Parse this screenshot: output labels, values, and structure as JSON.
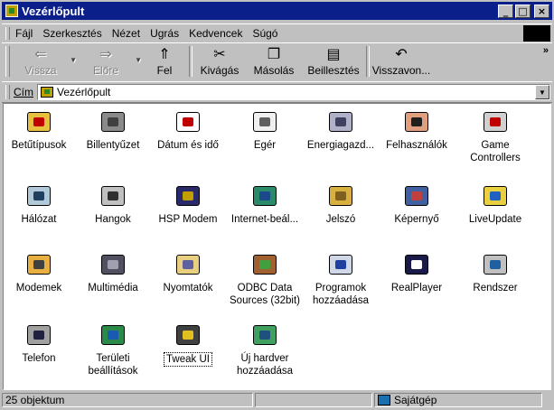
{
  "window": {
    "title": "Vezérlőpult"
  },
  "title_buttons": {
    "minimize": "_",
    "maximize": "□",
    "close": "×"
  },
  "menu": [
    "Fájl",
    "Szerkesztés",
    "Nézet",
    "Ugrás",
    "Kedvencek",
    "Súgó"
  ],
  "toolbar": {
    "back": "Vissza",
    "forward": "Előre",
    "up": "Fel",
    "cut": "Kivágás",
    "copy": "Másolás",
    "paste": "Beillesztés",
    "undo": "Visszavon...",
    "more": "»"
  },
  "address": {
    "label": "Cím",
    "value": "Vezérlőpult"
  },
  "items": [
    {
      "label": "Betűtípusok",
      "icon": "fonts-folder-icon"
    },
    {
      "label": "Billentyűzet",
      "icon": "keyboard-icon"
    },
    {
      "label": "Dátum és idő",
      "icon": "calendar-clock-icon"
    },
    {
      "label": "Egér",
      "icon": "mouse-icon"
    },
    {
      "label": "Energiagazd...",
      "icon": "power-plug-icon"
    },
    {
      "label": "Felhasználók",
      "icon": "users-icon"
    },
    {
      "label": "Game Controllers",
      "icon": "joystick-icon"
    },
    {
      "label": "Hálózat",
      "icon": "network-icon"
    },
    {
      "label": "Hangok",
      "icon": "speaker-icon"
    },
    {
      "label": "HSP Modem",
      "icon": "tools-icon"
    },
    {
      "label": "Internet-beál...",
      "icon": "globe-icon"
    },
    {
      "label": "Jelszó",
      "icon": "keys-icon"
    },
    {
      "label": "Képernyő",
      "icon": "monitor-icon"
    },
    {
      "label": "LiveUpdate",
      "icon": "antenna-icon"
    },
    {
      "label": "Modemek",
      "icon": "phone-icon"
    },
    {
      "label": "Multimédia",
      "icon": "multimedia-icon"
    },
    {
      "label": "Nyomtatók",
      "icon": "printer-folder-icon"
    },
    {
      "label": "ODBC Data Sources (32bit)",
      "icon": "database-icon"
    },
    {
      "label": "Programok hozzáadása",
      "icon": "add-programs-icon"
    },
    {
      "label": "RealPlayer",
      "icon": "realplayer-icon"
    },
    {
      "label": "Rendszer",
      "icon": "computer-icon"
    },
    {
      "label": "Telefon",
      "icon": "telephony-icon"
    },
    {
      "label": "Területi beállítások",
      "icon": "globe-region-icon"
    },
    {
      "label": "Tweak UI",
      "icon": "tweakui-icon"
    },
    {
      "label": "Új hardver hozzáadása",
      "icon": "add-hardware-icon"
    }
  ],
  "status": {
    "count": "25 objektum",
    "zone": "Sajátgép"
  },
  "colors": {
    "title_bar": "#0a1f8a",
    "window": "#c0c0c0",
    "content": "#ffffff"
  }
}
